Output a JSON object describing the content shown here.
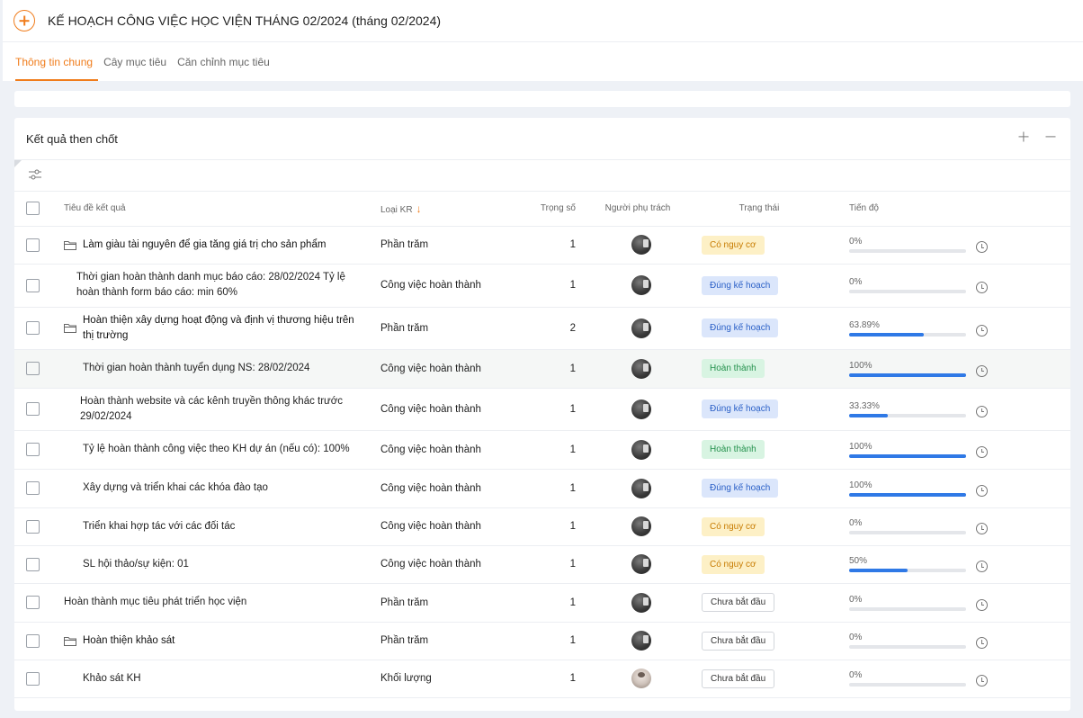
{
  "header": {
    "title": "KẾ HOẠCH CÔNG VIỆC HỌC VIỆN THÁNG 02/2024 (tháng 02/2024)"
  },
  "tabs": [
    {
      "label": "Thông tin chung",
      "active": true
    },
    {
      "label": "Cây mục tiêu",
      "active": false
    },
    {
      "label": "Căn chỉnh mục tiêu",
      "active": false
    }
  ],
  "key_results": {
    "title": "Kết quả then chốt",
    "columns": {
      "title": "Tiêu đề kết quả",
      "type": "Loại KR",
      "weight": "Trọng số",
      "owner": "Người phụ trách",
      "status": "Trạng thái",
      "progress": "Tiến độ"
    },
    "rows": [
      {
        "title": "Làm giàu tài nguyên để gia tăng giá trị cho sản phẩm",
        "type": "Phần trăm",
        "weight": "1",
        "status": "Có nguy cơ",
        "status_kind": "risk",
        "progress": "0%",
        "progress_value": 0,
        "folder": true
      },
      {
        "title": "Thời gian hoàn thành danh mục báo cáo: 28/02/2024 Tỷ lệ hoàn thành form báo cáo: min 60%",
        "type": "Công việc hoàn thành",
        "weight": "1",
        "status": "Đúng kế hoạch",
        "status_kind": "plan",
        "progress": "0%",
        "progress_value": 0,
        "folder": false
      },
      {
        "title": "Hoàn thiện xây dựng hoạt động và định vị thương hiệu trên thị trường",
        "type": "Phần trăm",
        "weight": "2",
        "status": "Đúng kế hoạch",
        "status_kind": "plan",
        "progress": "63.89%",
        "progress_value": 63.89,
        "folder": true
      },
      {
        "title": "Thời gian hoàn thành tuyển dụng NS: 28/02/2024",
        "type": "Công việc hoàn thành",
        "weight": "1",
        "status": "Hoàn thành",
        "status_kind": "done",
        "progress": "100%",
        "progress_value": 100,
        "folder": false
      },
      {
        "title": "Hoàn thành website và các kênh truyền thông khác trước 29/02/2024",
        "type": "Công việc hoàn thành",
        "weight": "1",
        "status": "Đúng kế hoạch",
        "status_kind": "plan",
        "progress": "33.33%",
        "progress_value": 33.33,
        "folder": false
      },
      {
        "title": "Tỷ lệ hoàn thành công việc theo KH dự án (nếu có): 100%",
        "type": "Công việc hoàn thành",
        "weight": "1",
        "status": "Hoàn thành",
        "status_kind": "done",
        "progress": "100%",
        "progress_value": 100,
        "folder": false
      },
      {
        "title": "Xây dựng và triển khai các khóa đào tạo",
        "type": "Công việc hoàn thành",
        "weight": "1",
        "status": "Đúng kế hoạch",
        "status_kind": "plan",
        "progress": "100%",
        "progress_value": 100,
        "folder": false
      },
      {
        "title": "Triển khai hợp tác với các đối tác",
        "type": "Công việc hoàn thành",
        "weight": "1",
        "status": "Có nguy cơ",
        "status_kind": "risk",
        "progress": "0%",
        "progress_value": 0,
        "folder": false
      },
      {
        "title": "SL hội thảo/sự kiện: 01",
        "type": "Công việc hoàn thành",
        "weight": "1",
        "status": "Có nguy cơ",
        "status_kind": "risk",
        "progress": "50%",
        "progress_value": 50,
        "folder": false
      },
      {
        "title": "Hoàn thành mục tiêu phát triển học viện",
        "type": "Phần trăm",
        "weight": "1",
        "status": "Chưa bắt đầu",
        "status_kind": "notstarted",
        "progress": "0%",
        "progress_value": 0,
        "folder": false
      },
      {
        "title": "Hoàn thiện khảo sát",
        "type": "Phần trăm",
        "weight": "1",
        "status": "Chưa bắt đầu",
        "status_kind": "notstarted",
        "progress": "0%",
        "progress_value": 0,
        "folder": true
      },
      {
        "title": "Khảo sát KH",
        "type": "Khối lượng",
        "weight": "1",
        "status": "Chưa bắt đầu",
        "status_kind": "notstarted",
        "progress": "0%",
        "progress_value": 0,
        "folder": false
      }
    ]
  },
  "colors": {
    "accent": "#f07c1b",
    "progress_fill": "#2f79e6"
  }
}
